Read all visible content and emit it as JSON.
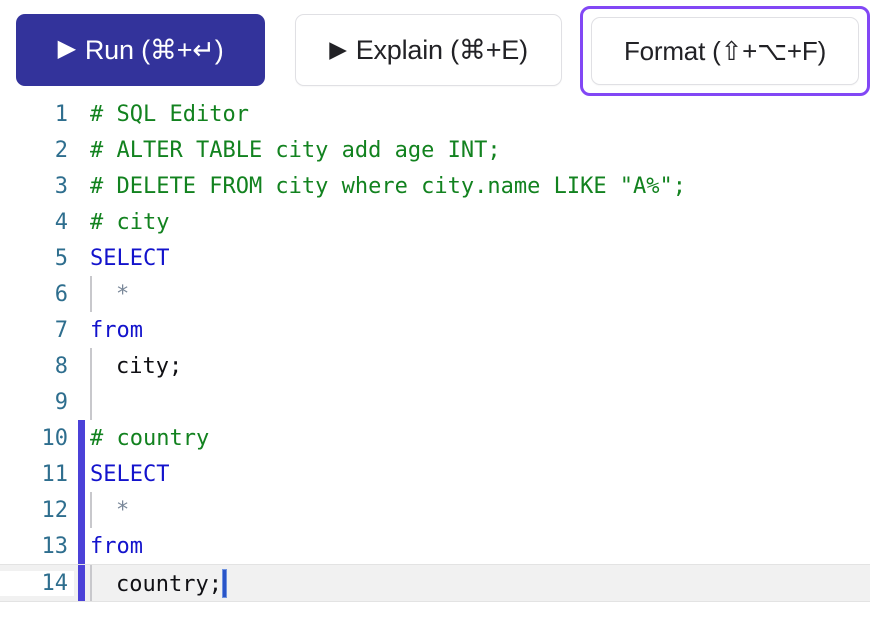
{
  "toolbar": {
    "buttons": [
      {
        "name": "run",
        "icon": "play-icon",
        "label": "Run (⌘+↵)",
        "variant": "primary",
        "focused": false
      },
      {
        "name": "explain",
        "icon": "play-icon",
        "label": "Explain (⌘+E)",
        "variant": "secondary",
        "focused": false
      },
      {
        "name": "format",
        "icon": null,
        "label": "Format (⇧+⌥+F)",
        "variant": "secondary",
        "focused": true
      }
    ],
    "focus_ring_color": "#8247F5",
    "primary_color": "#33339B"
  },
  "editor": {
    "caret_line": 14,
    "caret_after_text": "country;",
    "scope_bar_color": "#4B41D8",
    "scope_bar_lines": [
      10,
      11,
      12,
      13,
      14
    ],
    "colors": {
      "comment": "#12821F",
      "keyword": "#1313CC",
      "operator": "#7A8899",
      "plain": "#101014",
      "line_number": "#2E6E8E",
      "active_line": "#f1f1f1",
      "indent_guide": "#c8c8cc"
    },
    "lines": [
      {
        "num": "1",
        "indented": false,
        "scope": false,
        "active": false,
        "tokens": [
          {
            "t": "comment",
            "s": "# SQL Editor"
          }
        ]
      },
      {
        "num": "2",
        "indented": false,
        "scope": false,
        "active": false,
        "tokens": [
          {
            "t": "comment",
            "s": "# ALTER TABLE city add age INT;"
          }
        ]
      },
      {
        "num": "3",
        "indented": false,
        "scope": false,
        "active": false,
        "tokens": [
          {
            "t": "comment",
            "s": "# DELETE FROM city where city.name LIKE \"A%\";"
          }
        ]
      },
      {
        "num": "4",
        "indented": false,
        "scope": false,
        "active": false,
        "tokens": [
          {
            "t": "comment",
            "s": "# city"
          }
        ]
      },
      {
        "num": "5",
        "indented": false,
        "scope": false,
        "active": false,
        "tokens": [
          {
            "t": "keyword",
            "s": "SELECT"
          }
        ]
      },
      {
        "num": "6",
        "indented": true,
        "scope": false,
        "active": false,
        "tokens": [
          {
            "t": "operator",
            "s": "*"
          }
        ]
      },
      {
        "num": "7",
        "indented": false,
        "scope": false,
        "active": false,
        "tokens": [
          {
            "t": "keyword",
            "s": "from"
          }
        ]
      },
      {
        "num": "8",
        "indented": true,
        "scope": false,
        "active": false,
        "tokens": [
          {
            "t": "plain",
            "s": "city;"
          }
        ]
      },
      {
        "num": "9",
        "indented": true,
        "scope": false,
        "active": false,
        "tokens": [
          {
            "t": "plain",
            "s": ""
          }
        ]
      },
      {
        "num": "10",
        "indented": false,
        "scope": true,
        "active": false,
        "tokens": [
          {
            "t": "comment",
            "s": "# country"
          }
        ]
      },
      {
        "num": "11",
        "indented": false,
        "scope": true,
        "active": false,
        "tokens": [
          {
            "t": "keyword",
            "s": "SELECT"
          }
        ]
      },
      {
        "num": "12",
        "indented": true,
        "scope": true,
        "active": false,
        "tokens": [
          {
            "t": "operator",
            "s": "*"
          }
        ]
      },
      {
        "num": "13",
        "indented": false,
        "scope": true,
        "active": false,
        "tokens": [
          {
            "t": "keyword",
            "s": "from"
          }
        ]
      },
      {
        "num": "14",
        "indented": true,
        "scope": true,
        "active": true,
        "tokens": [
          {
            "t": "plain",
            "s": "country;"
          }
        ]
      }
    ]
  }
}
